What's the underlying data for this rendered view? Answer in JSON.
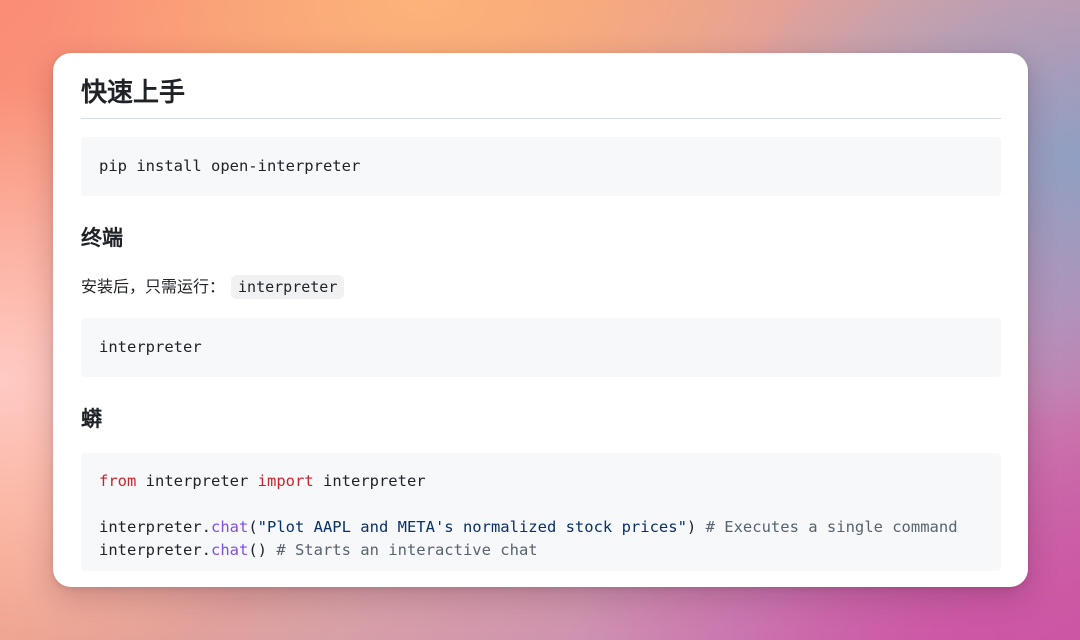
{
  "doc": {
    "title": "快速上手",
    "install_command": "pip install open-interpreter",
    "terminal_heading": "终端",
    "terminal_text": "安装后，只需运行：",
    "terminal_inline_code": "interpreter",
    "terminal_command": "interpreter",
    "python_heading": "蟒",
    "python_code": {
      "line1": {
        "kw_from": "from",
        "module": " interpreter ",
        "kw_import": "import",
        "name": " interpreter"
      },
      "line2": {
        "obj": "interpreter.",
        "fn": "chat",
        "open": "(",
        "str": "\"Plot AAPL and META's normalized stock prices\"",
        "close": ") ",
        "comment": "# Executes a single command"
      },
      "line3": {
        "obj": "interpreter.",
        "fn": "chat",
        "parens": "() ",
        "comment": "# Starts an interactive chat"
      }
    }
  },
  "colors": {
    "keyword": "#cf222e",
    "function": "#8250df",
    "string": "#0a3069",
    "comment": "#59636e",
    "code_bg": "#f6f8fa"
  }
}
